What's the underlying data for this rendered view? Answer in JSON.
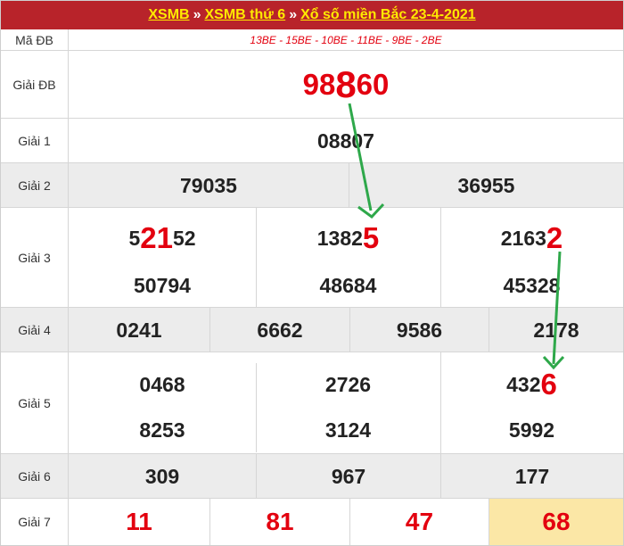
{
  "header": {
    "link1": "XSMB",
    "sep1": "»",
    "link2": "XSMB thứ 6",
    "sep2": "»",
    "link3": "Xổ số miền Bắc 23-4-2021"
  },
  "rows": {
    "madb": {
      "label": "Mã ĐB",
      "codes": "13BE - 15BE - 10BE - 11BE - 9BE - 2BE"
    },
    "db": {
      "label": "Giải ĐB",
      "a": "98",
      "b": "8",
      "c": "60"
    },
    "g1": {
      "label": "Giải 1",
      "v": "08807"
    },
    "g2": {
      "label": "Giải 2",
      "v1": "79035",
      "v2": "36955"
    },
    "g3": {
      "label": "Giải 3",
      "r1c1": {
        "a": "5",
        "b": "21",
        "c": "52"
      },
      "r1c2": {
        "a": "1382",
        "b": "5"
      },
      "r1c3": {
        "a": "2163",
        "b": "2"
      },
      "r2": [
        "50794",
        "48684",
        "45328"
      ]
    },
    "g4": {
      "label": "Giải 4",
      "v": [
        "0241",
        "6662",
        "9586",
        "2178"
      ]
    },
    "g5": {
      "label": "Giải 5",
      "r1": [
        "0468",
        "2726"
      ],
      "r1c3": {
        "a": "432",
        "b": "6"
      },
      "r2": [
        "8253",
        "3124",
        "5992"
      ]
    },
    "g6": {
      "label": "Giải 6",
      "v": [
        "309",
        "967",
        "177"
      ]
    },
    "g7": {
      "label": "Giải 7",
      "v": [
        "11",
        "81",
        "47",
        "68"
      ]
    }
  },
  "colors": {
    "header_bg": "#b8232a",
    "header_text": "#ffea00",
    "highlight": "#e3000f",
    "arrow": "#2ea84a",
    "g7_last_bg": "#fbe7a6"
  }
}
